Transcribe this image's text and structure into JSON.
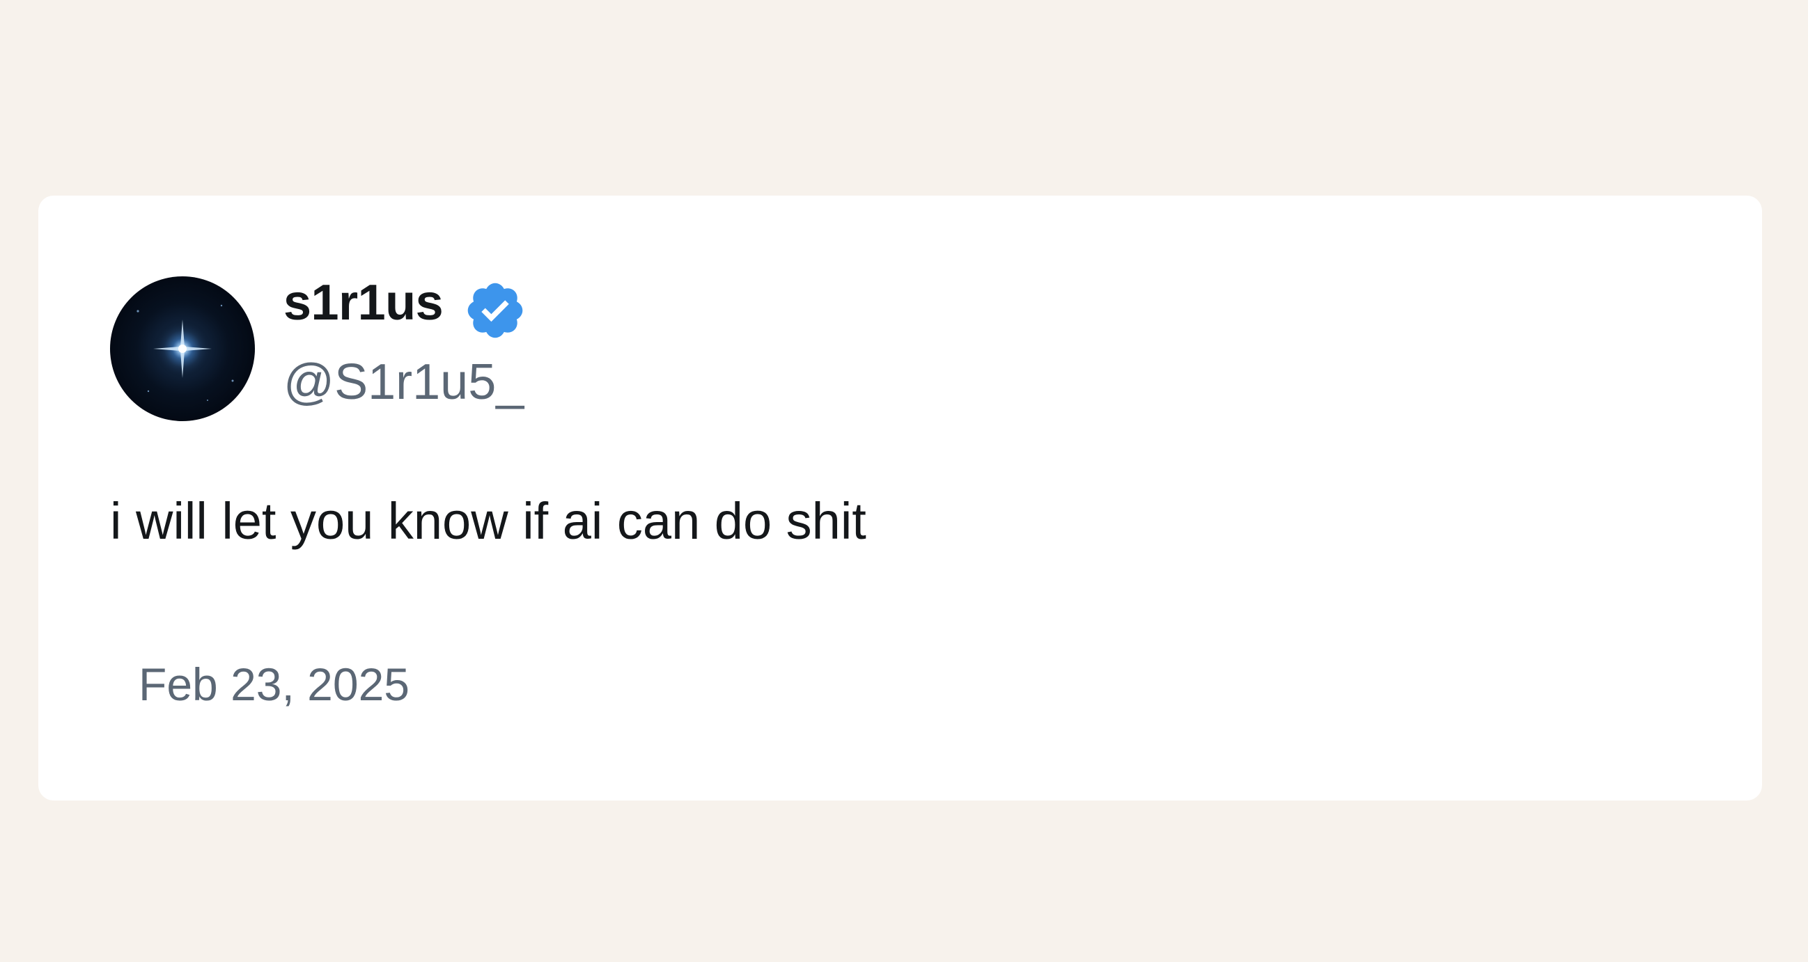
{
  "tweet": {
    "author": {
      "display_name": "s1r1us",
      "handle": "@S1r1u5_",
      "verified": true,
      "avatar_icon": "star-avatar-icon"
    },
    "text": "i will let you know if ai can do shit",
    "date": "Feb 23, 2025"
  },
  "colors": {
    "page_background": "#f7f2ec",
    "card_background": "#ffffff",
    "primary_text": "#14171a",
    "secondary_text": "#5b6775",
    "verified_badge": "#3d95ec"
  },
  "icons": {
    "verified": "verified-badge-icon"
  }
}
